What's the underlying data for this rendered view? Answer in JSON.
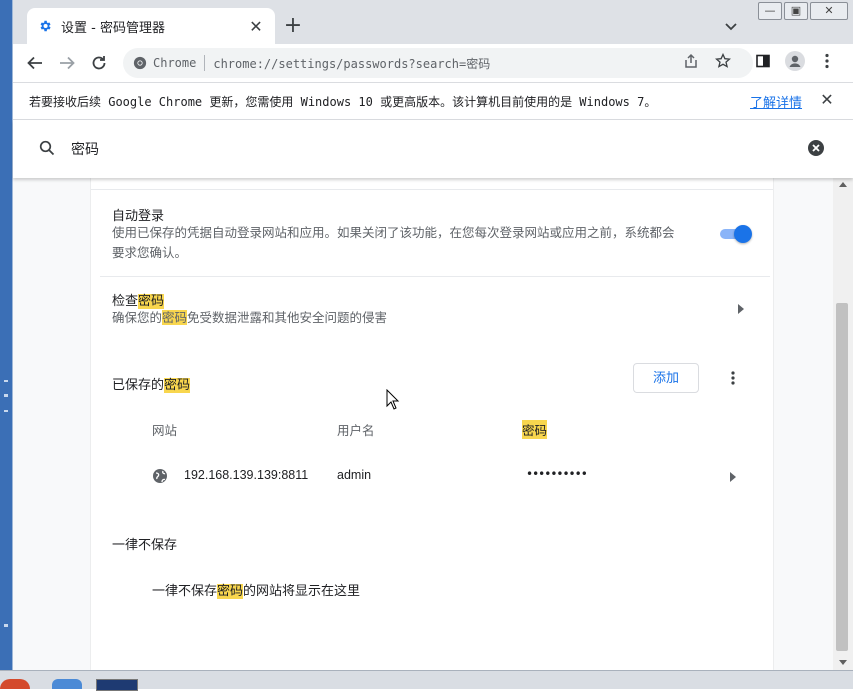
{
  "tab": {
    "title": "设置 - 密码管理器",
    "close_glyph": "✕"
  },
  "new_tab_glyph": "+",
  "omnibox": {
    "site_chip": "Chrome",
    "url": "chrome://settings/passwords?search=密码"
  },
  "infobar": {
    "message": "若要接收后续 Google Chrome 更新，您需使用 Windows 10 或更高版本。该计算机目前使用的是 Windows 7。",
    "link": "了解详情",
    "close_glyph": "✕"
  },
  "search": {
    "query": "密码"
  },
  "autosignin": {
    "title": "自动登录",
    "desc_line1": "使用已保存的凭据自动登录网站和应用。如果关闭了该功能，在您每次登录网站或应用之前，系统都会",
    "desc_line2": "要求您确认。",
    "enabled": true
  },
  "check": {
    "title_prefix": "检查",
    "title_hl": "密码",
    "desc_prefix": "确保您的",
    "desc_hl": "密码",
    "desc_suffix": "免受数据泄露和其他安全问题的侵害"
  },
  "saved": {
    "title_prefix": "已保存的",
    "title_hl": "密码",
    "add_label": "添加",
    "columns": {
      "site": "网站",
      "username": "用户名",
      "password": "密码"
    },
    "rows": [
      {
        "site": "192.168.139.139:8811",
        "username": "admin",
        "password": "••••••••••"
      }
    ]
  },
  "never": {
    "title": "一律不保存",
    "empty_prefix": "一律不保存",
    "empty_hl": "密码",
    "empty_suffix": "的网站将显示在这里"
  },
  "colors": {
    "accent": "#1a73e8",
    "highlight": "#f8d64e",
    "tabstrip": "#dee1e6"
  },
  "icons": [
    "gear-icon",
    "close-icon",
    "plus-icon",
    "chevron-down-icon",
    "back-arrow-icon",
    "forward-arrow-icon",
    "reload-icon",
    "chrome-logo-icon",
    "share-icon",
    "star-icon",
    "sidepanel-icon",
    "profile-icon",
    "menu-icon",
    "search-icon",
    "clear-icon",
    "chevron-right-icon",
    "kebab-icon",
    "globe-icon",
    "cursor-icon"
  ]
}
